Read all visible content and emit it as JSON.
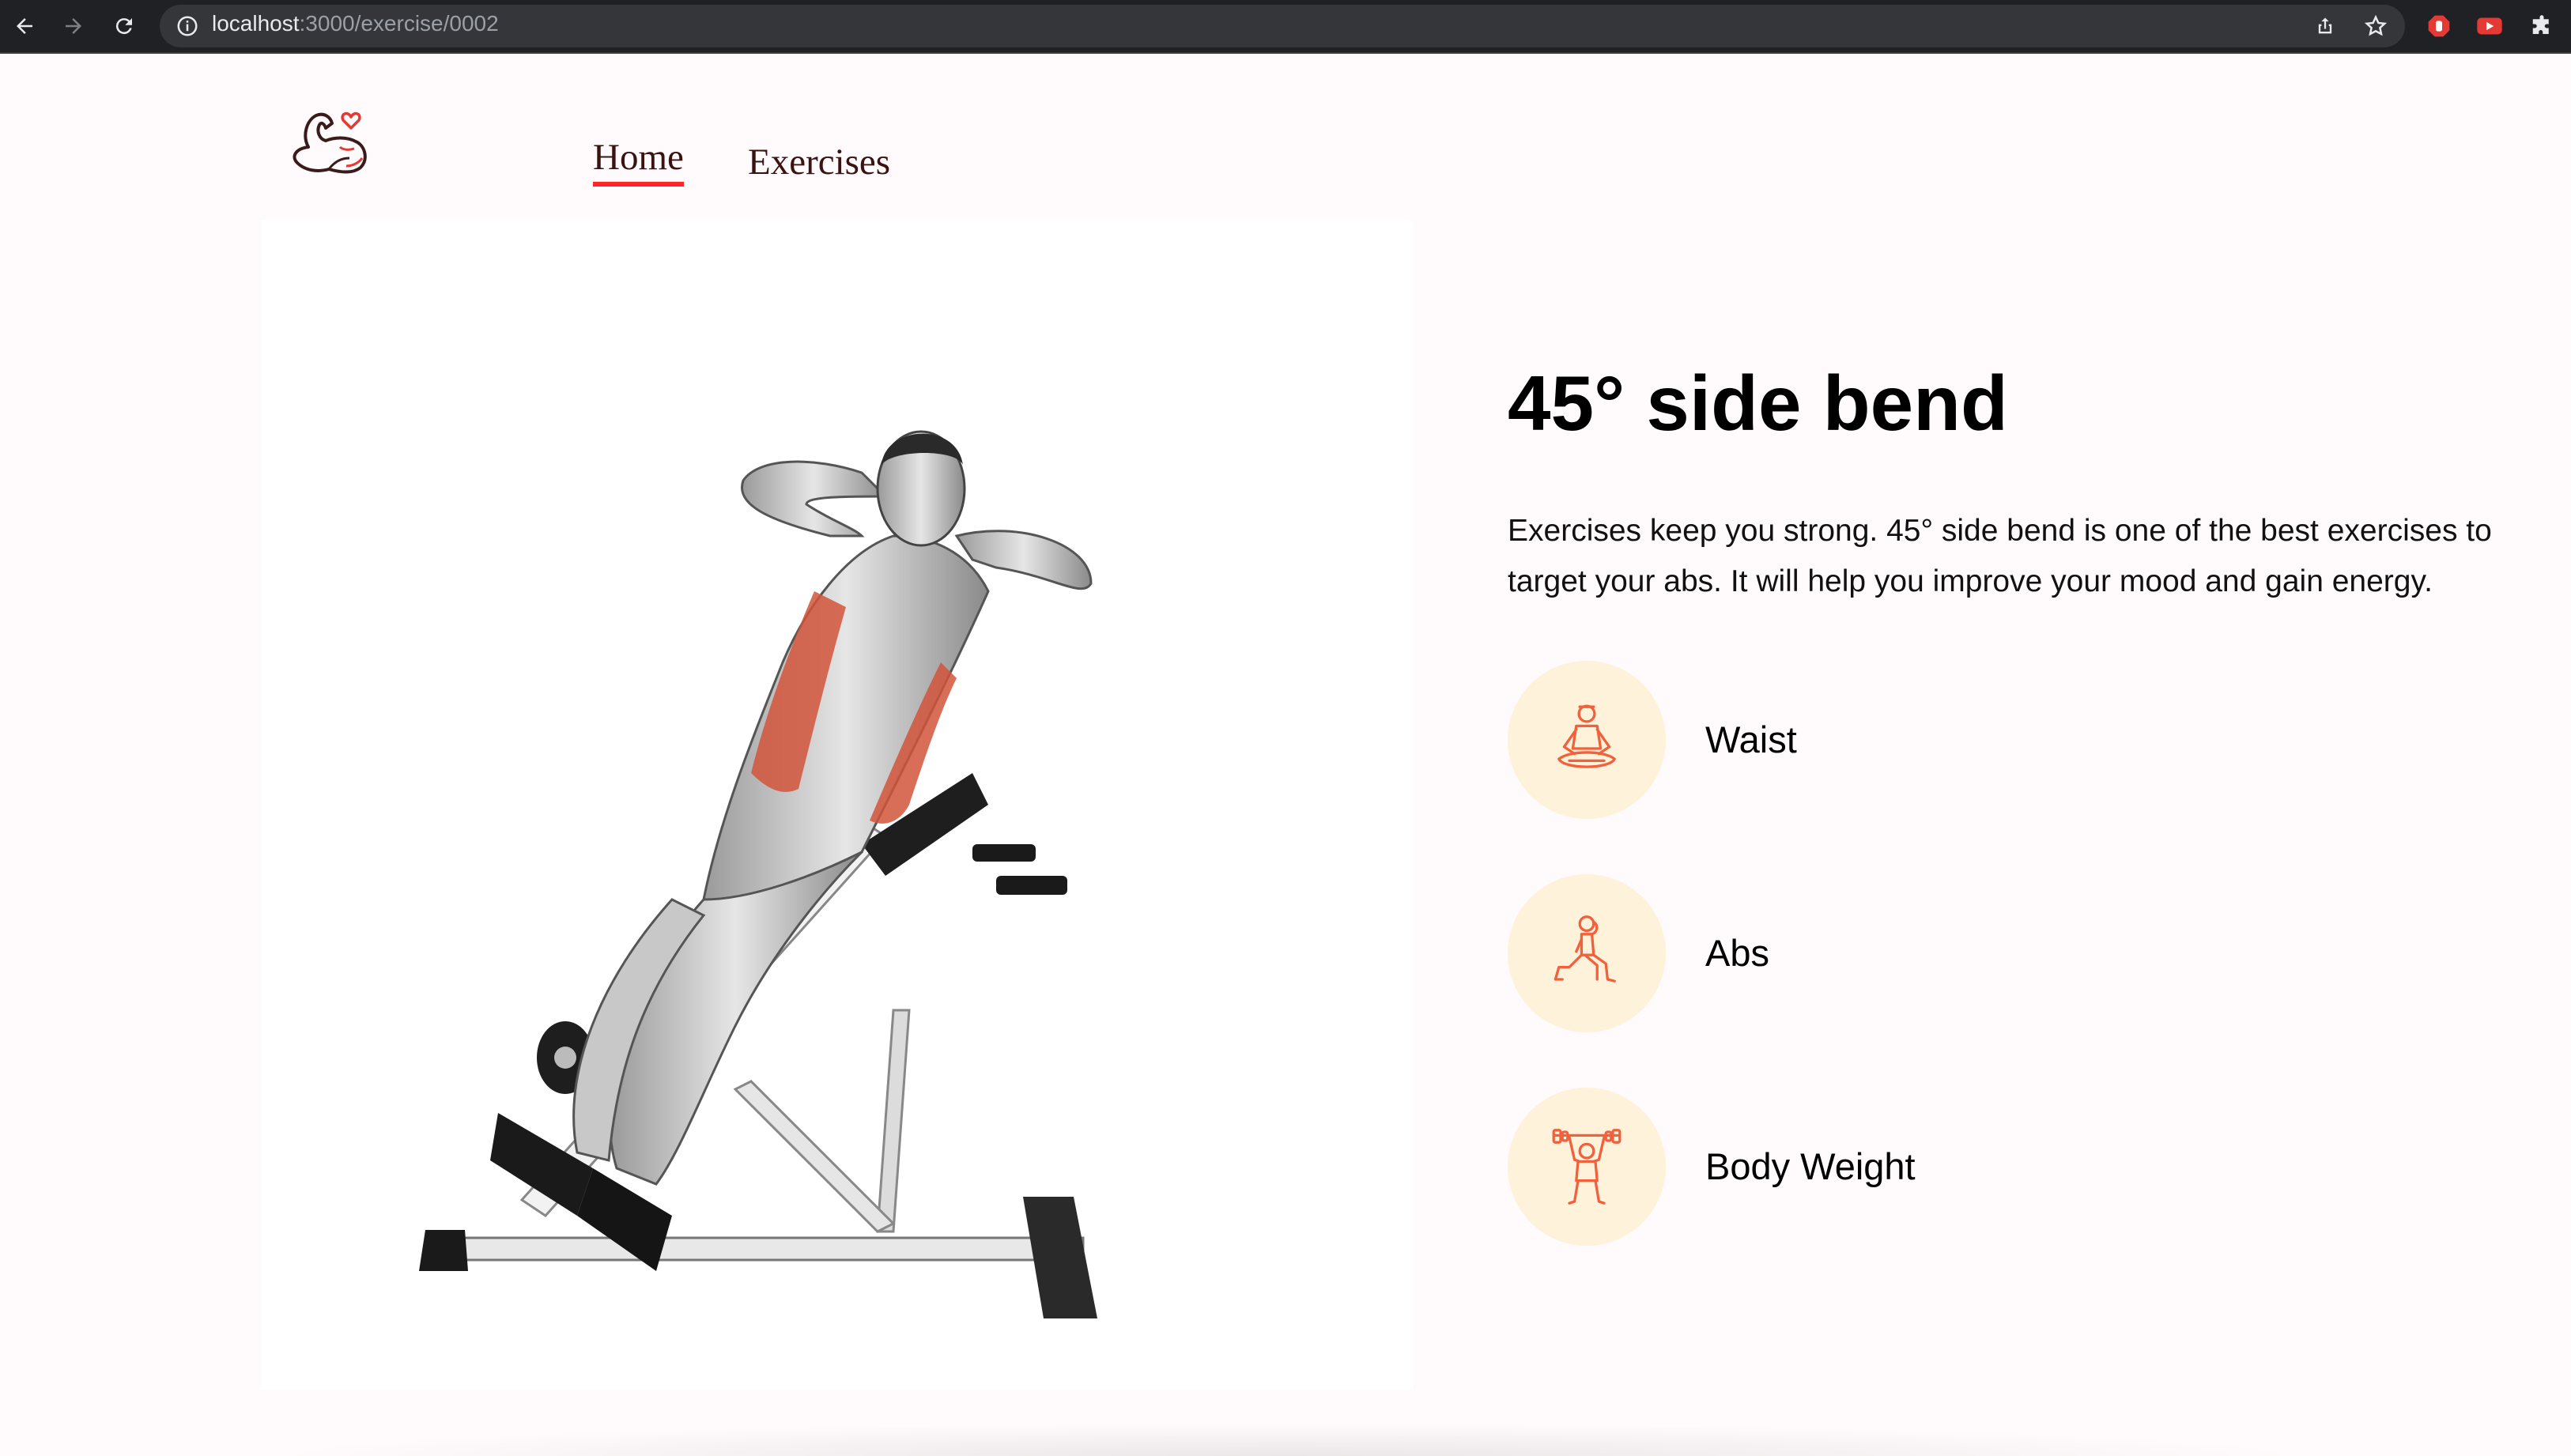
{
  "browser": {
    "url_host": "localhost",
    "url_path": ":3000/exercise/0002"
  },
  "nav": {
    "home_label": "Home",
    "exercises_label": "Exercises"
  },
  "exercise": {
    "name": "45° side bend",
    "description": "Exercises keep you strong. 45° side bend is one of the best exercises to target your abs. It will help you improve your mood and gain energy."
  },
  "tags": [
    {
      "label": "Waist",
      "icon": "meditation-icon"
    },
    {
      "label": "Abs",
      "icon": "lunge-icon"
    },
    {
      "label": "Body Weight",
      "icon": "weightlifter-icon"
    }
  ],
  "colors": {
    "accent": "#ff2625",
    "icon_orange": "#f0613c",
    "tag_bg": "#fff2db",
    "page_bg": "#fffafb"
  }
}
